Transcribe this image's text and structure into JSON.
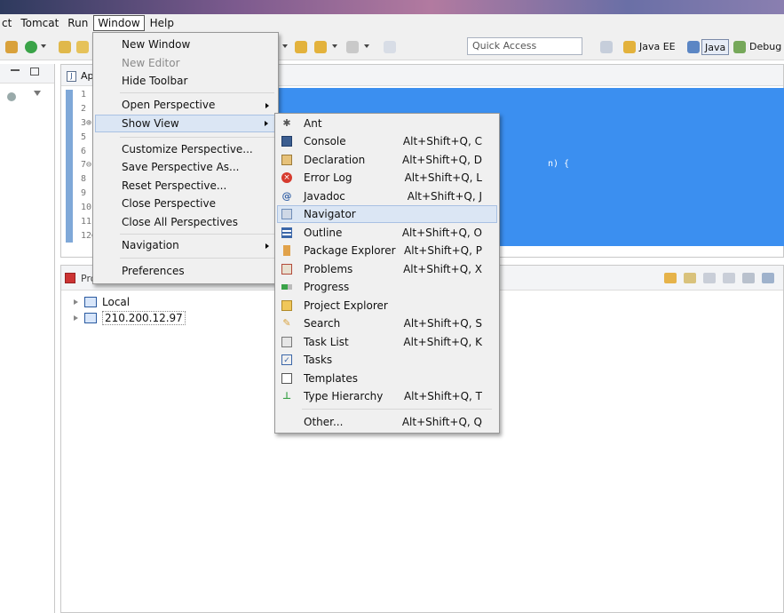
{
  "menubar": {
    "items": [
      "ct",
      "Tomcat",
      "Run",
      "Window",
      "Help"
    ]
  },
  "toolbar": {
    "quick_access": "Quick Access",
    "perspectives": [
      "Java EE",
      "Java",
      "Debug"
    ]
  },
  "editor": {
    "tab": "Ap",
    "line_numbers": [
      "1",
      "2",
      "3⊕",
      "5",
      "6",
      "7⊖",
      "8",
      "9",
      "10",
      "11",
      "12⊖"
    ],
    "code_fragment": "n) {"
  },
  "bottom_panel": {
    "tab": "Pro",
    "tree": [
      {
        "label": "Local"
      },
      {
        "label": "210.200.12.97"
      }
    ]
  },
  "window_menu": {
    "items": [
      {
        "label": "New Window",
        "disabled": false
      },
      {
        "label": "New Editor",
        "disabled": true
      },
      {
        "label": "Hide Toolbar",
        "disabled": false
      },
      {
        "label": "Open Perspective",
        "submenu": true
      },
      {
        "label": "Show View",
        "submenu": true,
        "highlighted": true
      },
      {
        "label": "Customize Perspective..."
      },
      {
        "label": "Save Perspective As..."
      },
      {
        "label": "Reset Perspective..."
      },
      {
        "label": "Close Perspective"
      },
      {
        "label": "Close All Perspectives"
      },
      {
        "label": "Navigation",
        "submenu": true
      },
      {
        "label": "Preferences"
      }
    ]
  },
  "show_view_menu": {
    "items": [
      {
        "label": "Ant",
        "shortcut": "",
        "icon": "ant-icon"
      },
      {
        "label": "Console",
        "shortcut": "Alt+Shift+Q, C",
        "icon": "console-icon"
      },
      {
        "label": "Declaration",
        "shortcut": "Alt+Shift+Q, D",
        "icon": "declaration-icon"
      },
      {
        "label": "Error Log",
        "shortcut": "Alt+Shift+Q, L",
        "icon": "error-log-icon"
      },
      {
        "label": "Javadoc",
        "shortcut": "Alt+Shift+Q, J",
        "icon": "javadoc-icon"
      },
      {
        "label": "Navigator",
        "shortcut": "",
        "icon": "navigator-icon"
      },
      {
        "label": "Outline",
        "shortcut": "Alt+Shift+Q, O",
        "icon": "outline-icon"
      },
      {
        "label": "Package Explorer",
        "shortcut": "Alt+Shift+Q, P",
        "icon": "package-explorer-icon"
      },
      {
        "label": "Problems",
        "shortcut": "Alt+Shift+Q, X",
        "icon": "problems-icon"
      },
      {
        "label": "Progress",
        "shortcut": "",
        "icon": "progress-icon"
      },
      {
        "label": "Project Explorer",
        "shortcut": "",
        "icon": "project-explorer-icon"
      },
      {
        "label": "Search",
        "shortcut": "Alt+Shift+Q, S",
        "icon": "search-icon"
      },
      {
        "label": "Task List",
        "shortcut": "Alt+Shift+Q, K",
        "icon": "task-list-icon"
      },
      {
        "label": "Tasks",
        "shortcut": "",
        "icon": "tasks-icon"
      },
      {
        "label": "Templates",
        "shortcut": "",
        "icon": "templates-icon"
      },
      {
        "label": "Type Hierarchy",
        "shortcut": "Alt+Shift+Q, T",
        "icon": "type-hierarchy-icon"
      },
      {
        "label": "Other...",
        "shortcut": "Alt+Shift+Q, Q",
        "icon": ""
      }
    ]
  }
}
